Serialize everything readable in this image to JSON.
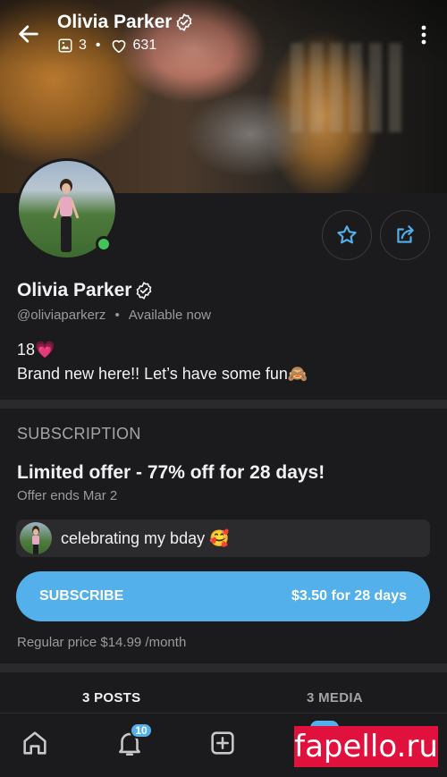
{
  "header": {
    "name": "Olivia Parker",
    "photos_count": "3",
    "dot": "•",
    "likes_count": "631"
  },
  "profile": {
    "name": "Olivia Parker",
    "handle": "@oliviaparkerz",
    "dot": "•",
    "status": "Available now",
    "bio_line1": "18💗",
    "bio_line2": "Brand new here!! Let’s have some fun🙈"
  },
  "subscription": {
    "section_title": "SUBSCRIPTION",
    "offer_title": "Limited offer - 77% off for 28 days!",
    "offer_ends": "Offer ends Mar 2",
    "message": "celebrating my bday 🥰",
    "button_label": "SUBSCRIBE",
    "button_price": "$3.50 for 28 days",
    "regular_price": "Regular price $14.99 /month"
  },
  "tabs": [
    {
      "label": "3 POSTS"
    },
    {
      "label": "3 MEDIA"
    }
  ],
  "bottom_nav": {
    "notifications_badge": "10"
  },
  "watermark": "fapello.ru",
  "colors": {
    "accent": "#53b0ea",
    "online": "#43c35a",
    "background": "#1b1b1d",
    "watermark_bg": "#e0123d"
  }
}
